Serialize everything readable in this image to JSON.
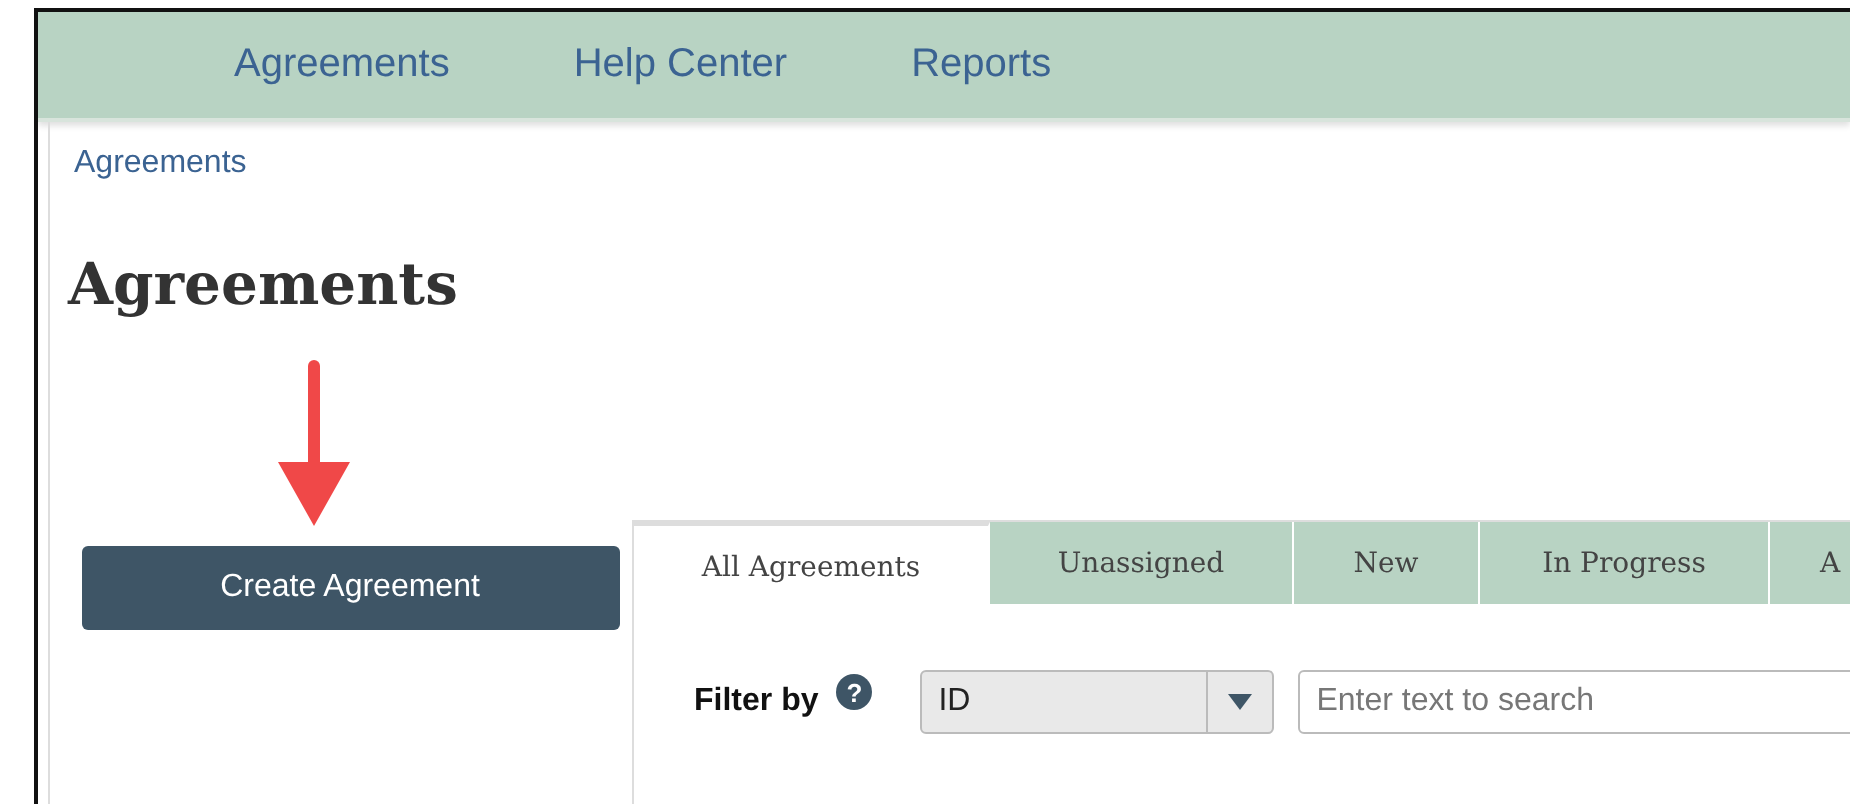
{
  "nav": {
    "items": [
      {
        "label": "Agreements"
      },
      {
        "label": "Help Center"
      },
      {
        "label": "Reports"
      }
    ]
  },
  "breadcrumb": "Agreements",
  "page_title": "Agreements",
  "create_button": "Create Agreement",
  "tabs": [
    {
      "label": "All Agreements",
      "selected": true
    },
    {
      "label": "Unassigned",
      "selected": false
    },
    {
      "label": "New",
      "selected": false
    },
    {
      "label": "In Progress",
      "selected": false
    },
    {
      "label": "A",
      "selected": false
    }
  ],
  "filter": {
    "label": "Filter by",
    "help": "?",
    "select_value": "ID",
    "search_placeholder": "Enter text to search"
  }
}
